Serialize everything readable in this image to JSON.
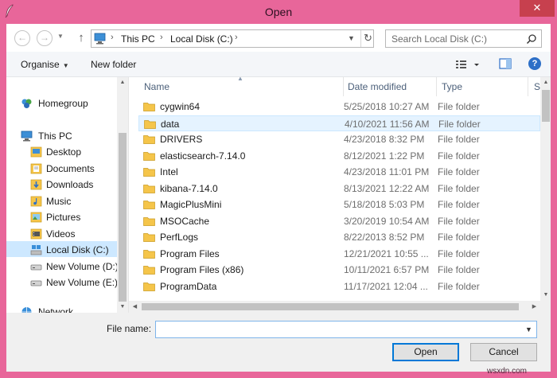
{
  "window": {
    "title": "Open",
    "close_glyph": "✕"
  },
  "colors": {
    "titlebar": "#e8669a",
    "close": "#c7404e",
    "selection": "#cde8ff",
    "folder": "#f5c54a"
  },
  "nav": {
    "back_glyph": "←",
    "forward_glyph": "→",
    "up_glyph": "↑",
    "breadcrumb": [
      "This PC",
      "Local Disk (C:)"
    ],
    "search_placeholder": "Search Local Disk (C:)"
  },
  "toolbar": {
    "organise_label": "Organise",
    "new_folder_label": "New folder",
    "help_glyph": "?"
  },
  "sidebar": {
    "items": [
      {
        "label": "Homegroup",
        "icon": "homegroup-icon"
      },
      {
        "label": "This PC",
        "icon": "computer-icon"
      },
      {
        "label": "Desktop",
        "icon": "desktop-folder-icon"
      },
      {
        "label": "Documents",
        "icon": "documents-folder-icon"
      },
      {
        "label": "Downloads",
        "icon": "downloads-folder-icon"
      },
      {
        "label": "Music",
        "icon": "music-folder-icon"
      },
      {
        "label": "Pictures",
        "icon": "pictures-folder-icon"
      },
      {
        "label": "Videos",
        "icon": "videos-folder-icon"
      },
      {
        "label": "Local Disk (C:)",
        "icon": "local-disk-icon",
        "selected": true
      },
      {
        "label": "New Volume (D:)",
        "icon": "drive-icon"
      },
      {
        "label": "New Volume (E:)",
        "icon": "drive-icon"
      },
      {
        "label": "Network",
        "icon": "network-icon"
      }
    ]
  },
  "columns": {
    "name": "Name",
    "date": "Date modified",
    "type": "Type",
    "size": "S"
  },
  "files": [
    {
      "name": "cygwin64",
      "date": "5/25/2018 10:27 AM",
      "type": "File folder"
    },
    {
      "name": "data",
      "date": "4/10/2021 11:56 AM",
      "type": "File folder",
      "selected": true
    },
    {
      "name": "DRIVERS",
      "date": "4/23/2018 8:32 PM",
      "type": "File folder"
    },
    {
      "name": "elasticsearch-7.14.0",
      "date": "8/12/2021 1:22 PM",
      "type": "File folder"
    },
    {
      "name": "Intel",
      "date": "4/23/2018 11:01 PM",
      "type": "File folder"
    },
    {
      "name": "kibana-7.14.0",
      "date": "8/13/2021 12:22 AM",
      "type": "File folder"
    },
    {
      "name": "MagicPlusMini",
      "date": "5/18/2018 5:03 PM",
      "type": "File folder"
    },
    {
      "name": "MSOCache",
      "date": "3/20/2019 10:54 AM",
      "type": "File folder"
    },
    {
      "name": "PerfLogs",
      "date": "8/22/2013 8:52 PM",
      "type": "File folder"
    },
    {
      "name": "Program Files",
      "date": "12/21/2021 10:55 ...",
      "type": "File folder"
    },
    {
      "name": "Program Files (x86)",
      "date": "10/11/2021 6:57 PM",
      "type": "File folder"
    },
    {
      "name": "ProgramData",
      "date": "11/17/2021 12:04 ...",
      "type": "File folder"
    }
  ],
  "footer": {
    "file_name_label": "File name:",
    "file_name_value": "",
    "open_label": "Open",
    "cancel_label": "Cancel"
  },
  "watermark": "wsxdn.com"
}
